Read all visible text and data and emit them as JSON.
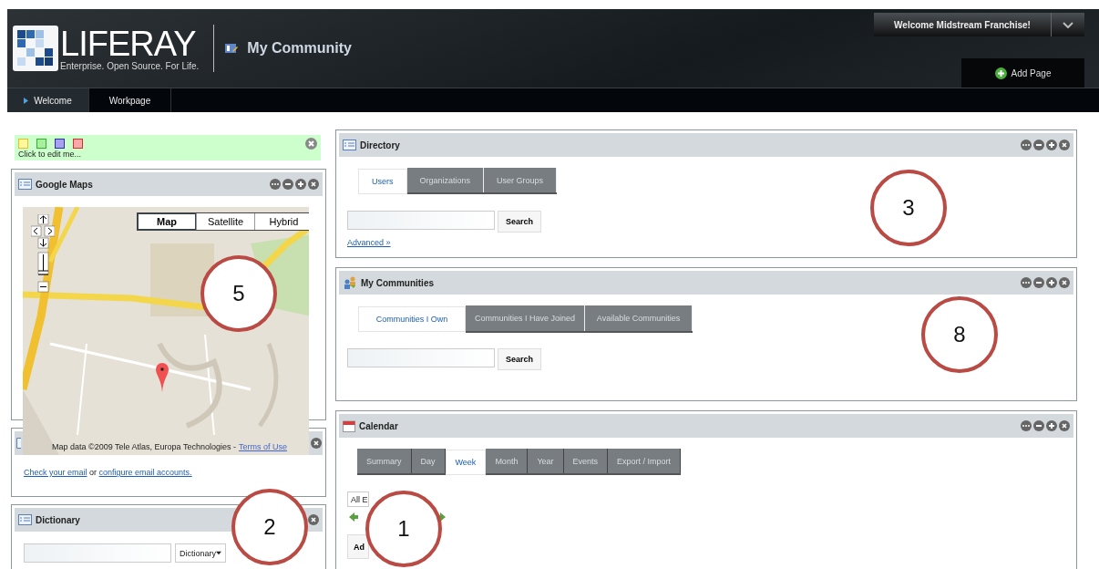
{
  "header": {
    "brand": "LIFERAY",
    "tagline": "Enterprise. Open Source. For Life.",
    "community_title": "My Community",
    "welcome": "Welcome Midstream Franchise!",
    "add_page": "Add Page",
    "nav_tabs": [
      {
        "label": "Welcome",
        "selected": true
      },
      {
        "label": "Workpage",
        "selected": false
      }
    ]
  },
  "sticky_note": {
    "colors": [
      {
        "color": "#fff8a0"
      },
      {
        "color": "#a8f0a0"
      },
      {
        "color": "#a8a0f0"
      },
      {
        "color": "#f8a8a8"
      }
    ],
    "text": "Click to edit me..."
  },
  "google_maps": {
    "title": "Google Maps",
    "map_types": [
      {
        "label": "Map",
        "selected": true
      },
      {
        "label": "Satellite",
        "selected": false
      },
      {
        "label": "Hybrid",
        "selected": false
      }
    ],
    "attribution": "Map data ©2009 Tele Atlas, Europa Technologies -",
    "terms_link": "Terms of Use"
  },
  "mail": {
    "check_link": "Check your email",
    "or": "or",
    "configure_link": "configure email accounts."
  },
  "dictionary": {
    "title": "Dictionary",
    "select_value": "Dictionary"
  },
  "directory": {
    "title": "Directory",
    "tabs": [
      {
        "label": "Users",
        "selected": true
      },
      {
        "label": "Organizations",
        "selected": false
      },
      {
        "label": "User Groups",
        "selected": false
      }
    ],
    "search_button": "Search",
    "advanced_link": "Advanced »"
  },
  "my_communities": {
    "title": "My Communities",
    "tabs": [
      {
        "label": "Communities I Own",
        "selected": true
      },
      {
        "label": "Communities I Have Joined",
        "selected": false
      },
      {
        "label": "Available Communities",
        "selected": false
      }
    ],
    "search_button": "Search"
  },
  "calendar": {
    "title": "Calendar",
    "tabs": [
      {
        "label": "Summary",
        "selected": false
      },
      {
        "label": "Day",
        "selected": false
      },
      {
        "label": "Week",
        "selected": true
      },
      {
        "label": "Month",
        "selected": false
      },
      {
        "label": "Year",
        "selected": false
      },
      {
        "label": "Events",
        "selected": false
      },
      {
        "label": "Export / Import",
        "selected": false
      }
    ],
    "select_value": "All E",
    "button_label": "Ad"
  },
  "annotations": [
    {
      "label": "5"
    },
    {
      "label": "3"
    },
    {
      "label": "8"
    },
    {
      "label": "2"
    },
    {
      "label": "1"
    }
  ]
}
